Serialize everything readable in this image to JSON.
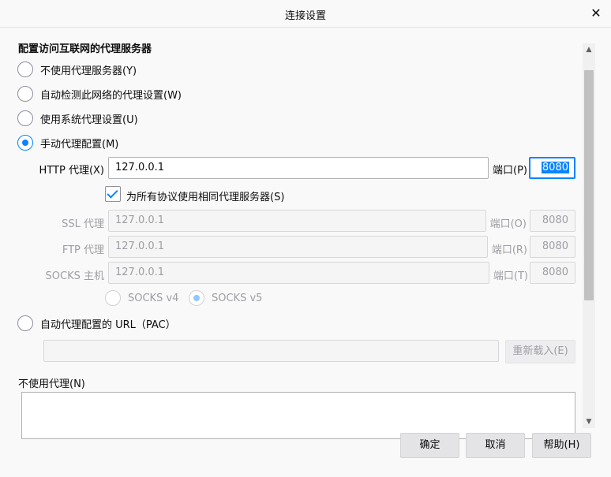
{
  "dialog": {
    "title": "连接设置",
    "close_glyph": "✕"
  },
  "section_title": "配置访问互联网的代理服务器",
  "proxy_options": [
    {
      "label": "不使用代理服务器(Y)",
      "checked": false
    },
    {
      "label": "自动检测此网络的代理设置(W)",
      "checked": false
    },
    {
      "label": "使用系统代理设置(U)",
      "checked": false
    },
    {
      "label": "手动代理配置(M)",
      "checked": true
    }
  ],
  "http": {
    "label": "HTTP 代理(X)",
    "host": "127.0.0.1",
    "port_label": "端口(P)",
    "port": "8080"
  },
  "same_proxy": {
    "label": "为所有协议使用相同代理服务器(S)",
    "checked": true
  },
  "ssl": {
    "label": "SSL 代理",
    "host": "127.0.0.1",
    "port_label": "端口(O)",
    "port": "8080"
  },
  "ftp": {
    "label": "FTP 代理",
    "host": "127.0.0.1",
    "port_label": "端口(R)",
    "port": "8080"
  },
  "socks": {
    "label": "SOCKS 主机",
    "host": "127.0.0.1",
    "port_label": "端口(T)",
    "port": "8080"
  },
  "socks_versions": [
    {
      "label": "SOCKS v4",
      "checked": false
    },
    {
      "label": "SOCKS v5",
      "checked": true
    }
  ],
  "pac": {
    "label": "自动代理配置的 URL（PAC）",
    "url": "",
    "reload_label": "重新载入(E)"
  },
  "no_proxy": {
    "label": "不使用代理(N)",
    "value": ""
  },
  "footer": {
    "ok_label": "确定",
    "cancel_label": "取消",
    "help_label": "帮助(H)"
  },
  "scrollbar": {
    "up_glyph": "▲",
    "down_glyph": "▼"
  },
  "colors": {
    "accent": "#0a84ff",
    "disabled_text": "#9e9ea3"
  }
}
